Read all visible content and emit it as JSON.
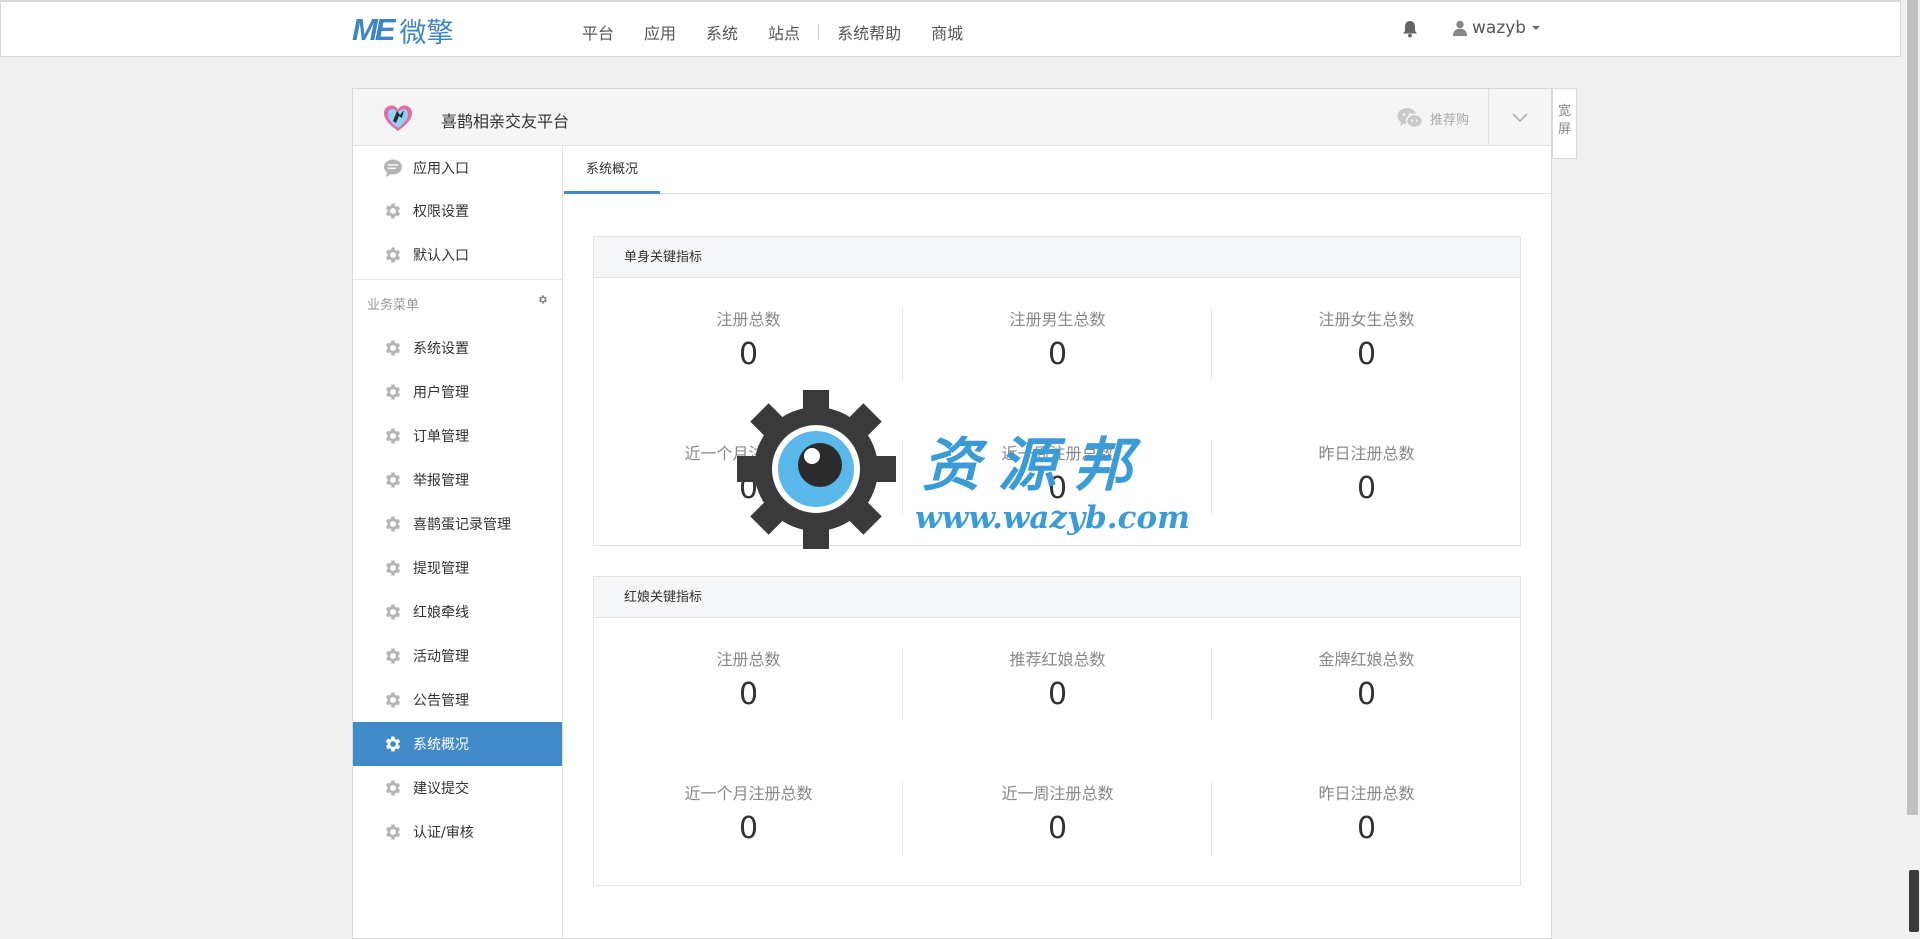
{
  "header": {
    "logo_mark": "ME",
    "logo_text": "微擎",
    "nav": [
      "平台",
      "应用",
      "系统",
      "站点",
      "系统帮助",
      "商城"
    ],
    "username": "wazyb"
  },
  "panel": {
    "app_title": "喜鹊相亲交友平台",
    "recommend_label": "推荐购",
    "wide_label": "宽屏"
  },
  "sidebar": {
    "top_items": [
      {
        "label": "应用入口",
        "icon": "chat-bubble-icon"
      },
      {
        "label": "权限设置",
        "icon": "gear-icon"
      },
      {
        "label": "默认入口",
        "icon": "gear-icon"
      }
    ],
    "section_title": "业务菜单",
    "menu_items": [
      {
        "label": "系统设置"
      },
      {
        "label": "用户管理"
      },
      {
        "label": "订单管理"
      },
      {
        "label": "举报管理"
      },
      {
        "label": "喜鹊蛋记录管理"
      },
      {
        "label": "提现管理"
      },
      {
        "label": "红娘牵线"
      },
      {
        "label": "活动管理"
      },
      {
        "label": "公告管理"
      },
      {
        "label": "系统概况",
        "active": true
      },
      {
        "label": "建议提交"
      },
      {
        "label": "认证/审核"
      }
    ]
  },
  "main": {
    "tab": "系统概况",
    "cards": [
      {
        "title": "单身关键指标",
        "stats": [
          {
            "label": "注册总数",
            "value": "0"
          },
          {
            "label": "注册男生总数",
            "value": "0"
          },
          {
            "label": "注册女生总数",
            "value": "0"
          },
          {
            "label": "近一个月注册总数",
            "value": "0"
          },
          {
            "label": "近一周注册总数",
            "value": "0"
          },
          {
            "label": "昨日注册总数",
            "value": "0"
          }
        ]
      },
      {
        "title": "红娘关键指标",
        "stats": [
          {
            "label": "注册总数",
            "value": "0"
          },
          {
            "label": "推荐红娘总数",
            "value": "0"
          },
          {
            "label": "金牌红娘总数",
            "value": "0"
          },
          {
            "label": "近一个月注册总数",
            "value": "0"
          },
          {
            "label": "近一周注册总数",
            "value": "0"
          },
          {
            "label": "昨日注册总数",
            "value": "0"
          }
        ]
      }
    ]
  },
  "watermark": {
    "title": "资源邦",
    "url": "www.wazyb.com"
  },
  "colors": {
    "accent": "#428bca",
    "logo": "#3d85c6",
    "watermark_gear": "#3a3a3a",
    "watermark_eye": "#5bb8ea"
  }
}
